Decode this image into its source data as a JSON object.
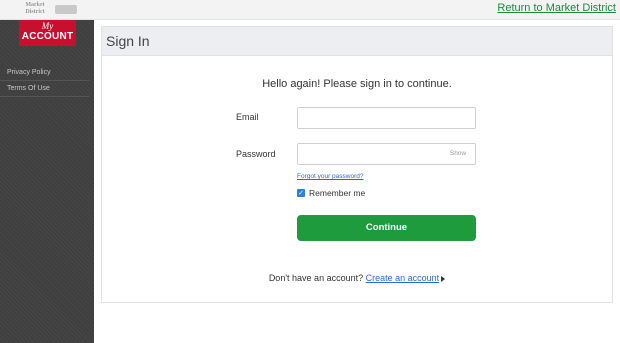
{
  "topbar": {
    "brands": [
      "",
      "Market District",
      "",
      ""
    ],
    "return_link": "Return to Market District"
  },
  "logo": {
    "my": "My",
    "account": "ACCOUNT"
  },
  "sidebar": {
    "items": [
      {
        "label": "Privacy Policy"
      },
      {
        "label": "Terms Of Use"
      }
    ]
  },
  "signin": {
    "title": "Sign In",
    "headline": "Hello again! Please sign in to continue.",
    "email_label": "Email",
    "password_label": "Password",
    "email_value": "",
    "password_value": "",
    "show_label": "Show",
    "forgot_label": "Forgot your password?",
    "remember_label": "Remember me",
    "remember_checked": true,
    "continue_label": "Continue",
    "no_account_text": "Don't have an account?",
    "create_label": "Create an account"
  },
  "colors": {
    "brand_red": "#c8102e",
    "accent_green": "#1e9b3c",
    "link_blue": "#2a6bd1",
    "sidebar_bg": "#3f3f3f"
  }
}
